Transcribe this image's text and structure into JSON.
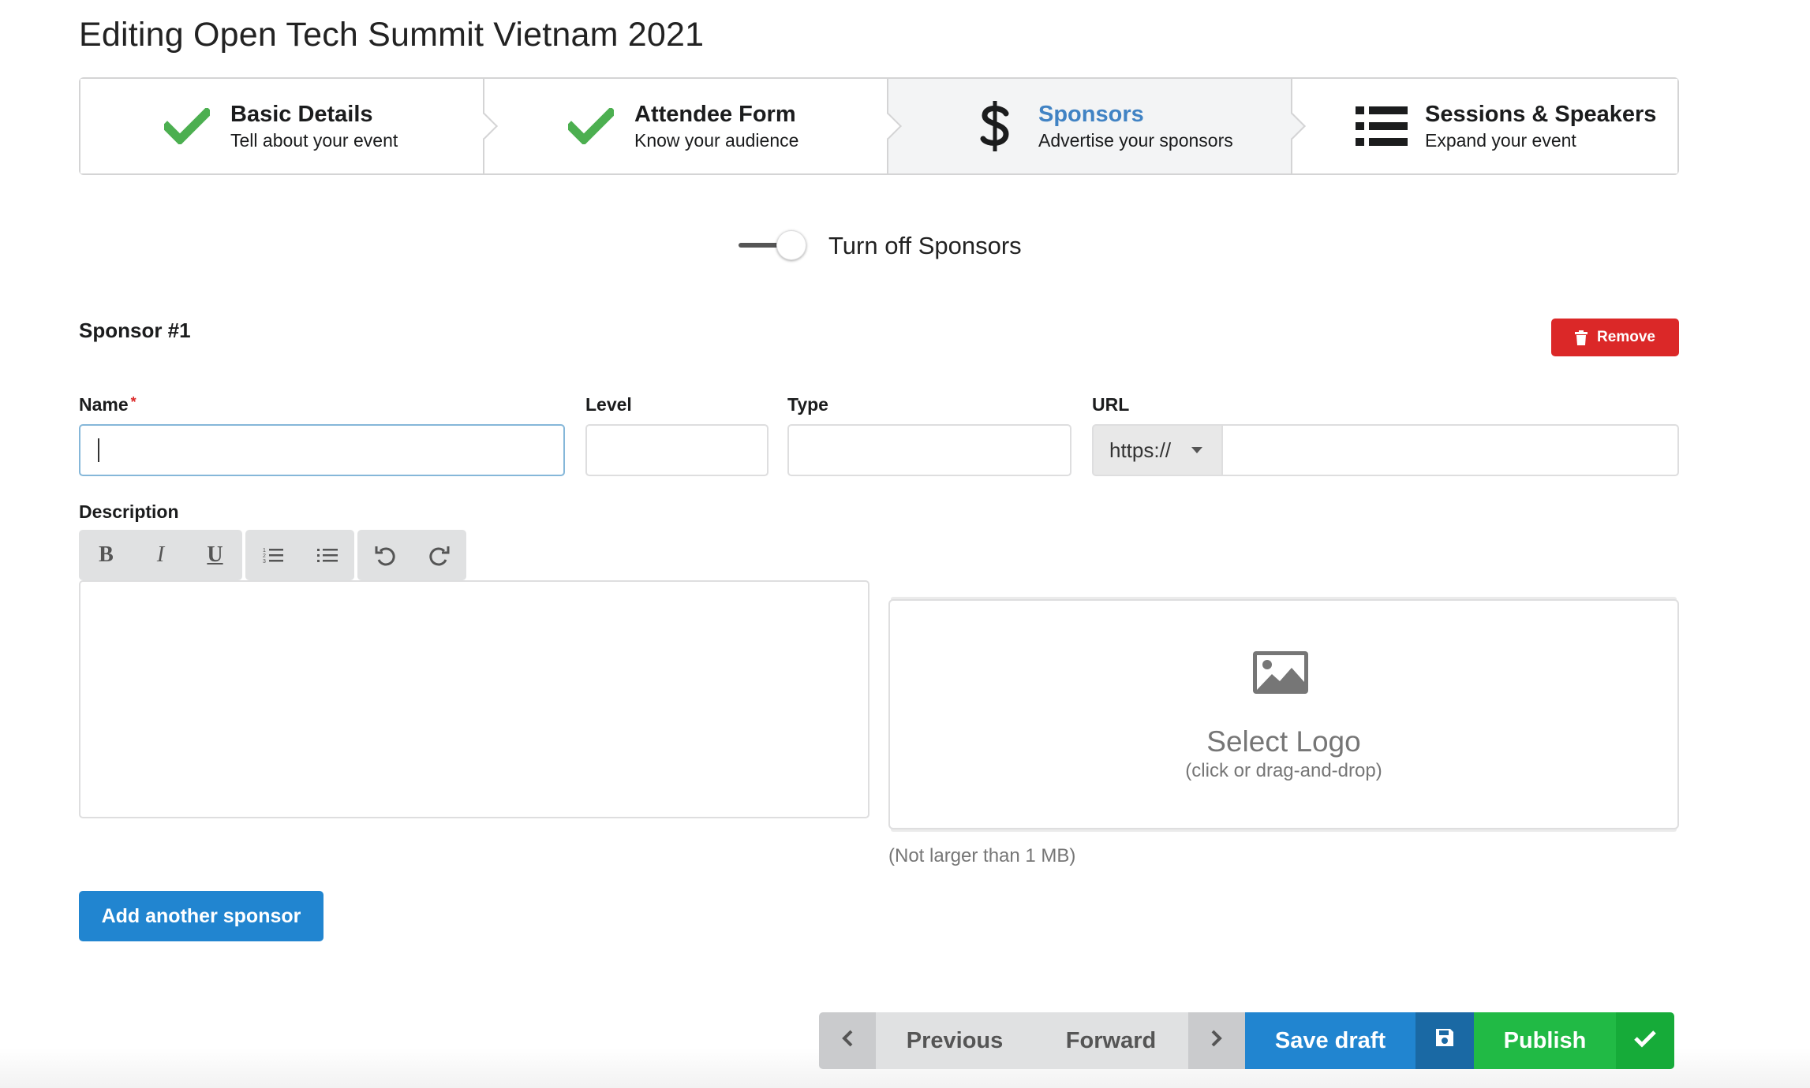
{
  "page": {
    "title": "Editing Open Tech Summit Vietnam 2021"
  },
  "steps": [
    {
      "title": "Basic Details",
      "description": "Tell about your event",
      "icon": "check-icon",
      "state": "completed"
    },
    {
      "title": "Attendee Form",
      "description": "Know your audience",
      "icon": "check-icon",
      "state": "completed"
    },
    {
      "title": "Sponsors",
      "description": "Advertise your sponsors",
      "icon": "dollar-icon",
      "state": "active"
    },
    {
      "title": "Sessions & Speakers",
      "description": "Expand your event",
      "icon": "list-icon",
      "state": "pending"
    }
  ],
  "toggle": {
    "label": "Turn off Sponsors",
    "on": true
  },
  "sponsor": {
    "heading": "Sponsor #1",
    "remove_label": "Remove",
    "fields": {
      "name_label": "Name",
      "name_required": "*",
      "name_value": "",
      "level_label": "Level",
      "level_value": "",
      "type_label": "Type",
      "type_value": "",
      "url_label": "URL",
      "url_protocol": "https://",
      "url_value": "",
      "description_label": "Description"
    },
    "editor_toolbar": [
      "bold-icon",
      "italic-icon",
      "underline-icon",
      "ordered-list-icon",
      "unordered-list-icon",
      "undo-icon",
      "redo-icon"
    ],
    "toolbar_glyphs": {
      "bold": "B",
      "italic": "I",
      "underline": "U"
    },
    "logo": {
      "title": "Select Logo",
      "subtitle": "(click or drag-and-drop)",
      "note": "(Not larger than 1 MB)"
    }
  },
  "actions": {
    "add_sponsor": "Add another sponsor",
    "previous": "Previous",
    "forward": "Forward",
    "save_draft": "Save draft",
    "publish": "Publish"
  },
  "colors": {
    "accent_blue": "#2185d0",
    "link_blue": "#4183c4",
    "success_green": "#21ba45",
    "check_green": "#4caf50",
    "danger_red": "#db2828"
  }
}
